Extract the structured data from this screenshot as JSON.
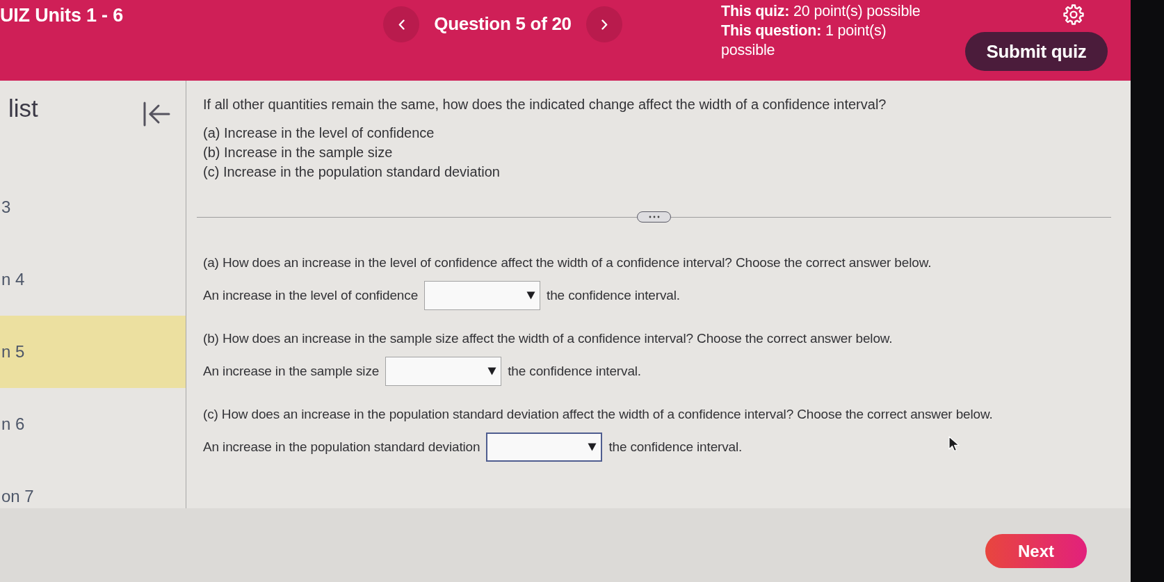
{
  "header": {
    "title": "UIZ Units 1 - 6",
    "question_counter": "Question 5 of 20",
    "points": [
      "**This quiz:** 20 point(s) possible",
      "**This question:** 1 point(s) possible"
    ],
    "submit_button": "Submit quiz"
  },
  "sidebar": {
    "title": "list",
    "items": [
      {
        "label": "3",
        "selected": false
      },
      {
        "label": "n 4",
        "selected": false
      },
      {
        "label": "n 5",
        "selected": true
      },
      {
        "label": "n 6",
        "selected": false
      },
      {
        "label": "on 7",
        "selected": false
      }
    ]
  },
  "question": {
    "prompt": "If all other quantities remain the same, how does the indicated change affect the width of a confidence interval?",
    "changes": [
      "(a) Increase in the level of confidence",
      "(b) Increase in the sample size",
      "(c) Increase in the population standard deviation"
    ]
  },
  "parts": [
    {
      "question": "(a) How does an increase in the level of confidence affect the width of a confidence interval? Choose the correct answer below.",
      "before": "An increase in the level of confidence",
      "after": "the confidence interval.",
      "focused": false
    },
    {
      "question": "(b) How does an increase in the sample size affect the width of a confidence interval? Choose the correct answer below.",
      "before": "An increase in the sample size",
      "after": "the confidence interval.",
      "focused": false
    },
    {
      "question": "(c) How does an increase in the population standard deviation affect the width of a confidence interval? Choose the correct answer below.",
      "before": "An increase in the population standard deviation",
      "after": "the confidence interval.",
      "focused": true
    }
  ],
  "footer": {
    "next_button": "Next"
  }
}
